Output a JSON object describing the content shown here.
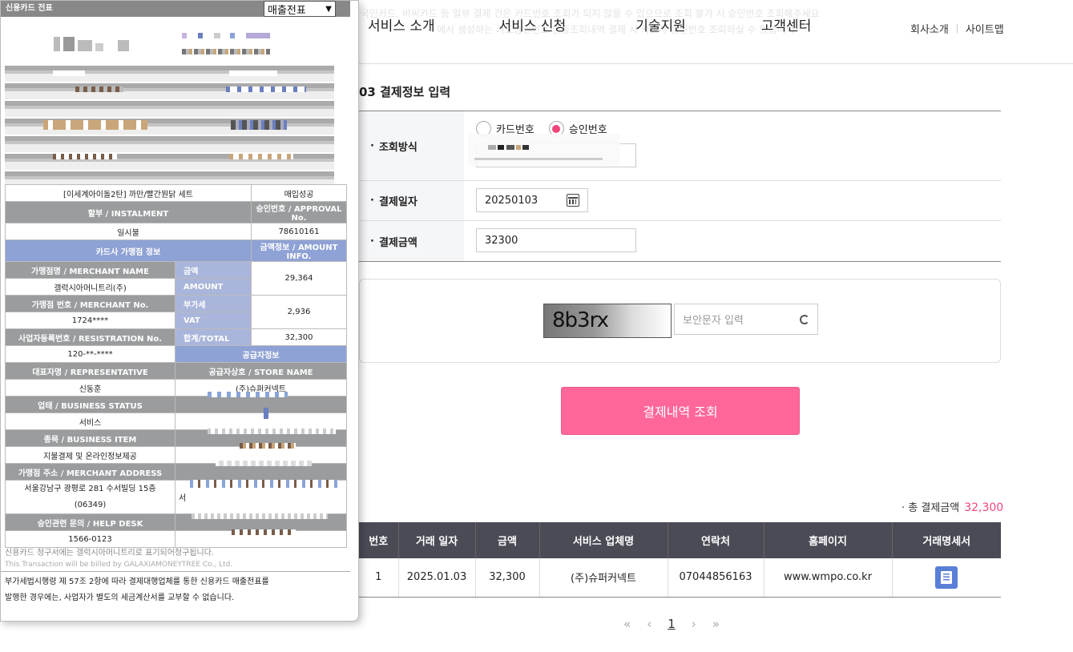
{
  "header": {
    "notice_line1": "국민카드, 비씨카드 등 일부 결제 건은 카드번호 조회가 되지 않을 수 있으므로 조회 불가 시 승인번호 조회해주세요",
    "notice_line2": "에서 생성하는 카드승인번호 인증조회내역 결제 시 카드사 승인번호 조회하실 수 있습니다",
    "nav": [
      "서비스 소개",
      "서비스 신청",
      "기술지원",
      "고객센터"
    ],
    "util_links": [
      "회사소개",
      "사이트맵"
    ]
  },
  "form": {
    "section_title": "03 결제정보 입력",
    "method_label": "조회방식",
    "method_options": [
      "카드번호",
      "승인번호"
    ],
    "method_selected": "승인번호",
    "date_label": "결제일자",
    "date_value": "20250103",
    "amount_label": "결제금액",
    "amount_value": "32300"
  },
  "captcha": {
    "image_text": "8b3rx",
    "placeholder": "보안문자 입력"
  },
  "search_button": "결제내역 조회",
  "total": {
    "label": "· 총 결제금액",
    "amount": "32,300"
  },
  "results": {
    "headers": [
      "번호",
      "거래 일자",
      "금액",
      "서비스 업체명",
      "연락처",
      "홈페이지",
      "거래명세서"
    ],
    "rows": [
      {
        "no": "1",
        "date": "2025.01.03",
        "amount": "32,300",
        "company": "(주)슈퍼커넥트",
        "phone": "07044856163",
        "homepage": "www.wmpo.co.kr"
      }
    ]
  },
  "pager": {
    "first": "«",
    "prev": "‹",
    "current": "1",
    "next": "›",
    "last": "»"
  },
  "popup": {
    "title": "신용카드 전표",
    "select_value": "매출전표",
    "receipt": {
      "product": "[이세계아이돌2탄] 까만/빨간뭔닭 세트",
      "status": "매입성공",
      "installment_label": "할부 / INSTALMENT",
      "approval_label": "승인번호 / APPROVAL No.",
      "installment_value": "일시불",
      "approval_value": "78610161",
      "merchant_info_label": "카드사 가맹점 정보",
      "amount_info_label": "금액정보 / AMOUNT INFO.",
      "merchant_name_label": "가맹점명 / MERCHANT NAME",
      "amount_label": "금액",
      "amount_label_en": "AMOUNT",
      "amount_value": "29,364",
      "merchant_name_value": "갤럭시아머니트리(주)",
      "merchant_no_label": "가맹점 번호 / MERCHANT No.",
      "vat_label": "부가세",
      "vat_label_en": "VAT",
      "vat_value": "2,936",
      "merchant_no_value": "1724****",
      "registration_label": "사업자등록번호 / RESISTRATION No.",
      "total_label": "합계/TOTAL",
      "total_value": "32,300",
      "registration_value": "120-**-****",
      "supplier_label": "공급자정보",
      "representative_label": "대표자명 / REPRESENTATIVE",
      "store_name_label": "공급자상호 / STORE NAME",
      "representative_value": "신동훈",
      "store_name_value": "(주)슈퍼커넥트",
      "business_status_label": "업태 / BUSINESS STATUS",
      "business_status_value": "서비스",
      "business_item_label": "종목 / BUSINESS ITEM",
      "business_item_value": "지불결제 및 온라인정보제공",
      "address_label": "가맹점 주소 / MERCHANT ADDRESS",
      "address_value": "서울강남구 광평로 281 수서빌딩 15층",
      "address_zip": "(06349)",
      "address_right_start": "서",
      "help_desk_label": "승인관련 문의 / HELP DESK",
      "help_desk_value": "1566-0123"
    },
    "note_kr": "신용카드 청구서에는 갤럭시아머니트리로 표기되어청구됩니다.",
    "note_en": "This Transaction will be billed by GALAXIAMONEYTREE Co., Ltd.",
    "legal_line1": "부가세법시행령 제 57조 2항에 따라 결제대행업체를 통한 신용카드 매출전표를",
    "legal_line2": "발행한 경우에는, 사업자가 별도의 세금계산서를 교부할 수 없습니다."
  },
  "colors": {
    "accent_pink": "#ff6699",
    "table_header": "#4a4b55",
    "receipt_gray": "#9a9c9e",
    "receipt_blue": "#8fa2d5",
    "receipt_light_blue": "#a9b5da",
    "doc_icon_blue": "#5a7fd6"
  },
  "icons": [
    "calendar-icon",
    "refresh-icon",
    "document-icon",
    "chevron-down-icon"
  ]
}
